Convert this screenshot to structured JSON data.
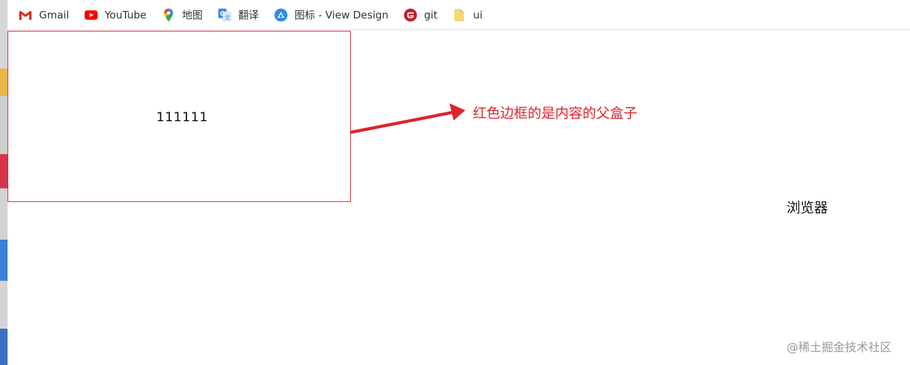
{
  "bookmarks": [
    {
      "label": "Gmail",
      "icon": "gmail-icon"
    },
    {
      "label": "YouTube",
      "icon": "youtube-icon"
    },
    {
      "label": "地图",
      "icon": "maps-pin-icon"
    },
    {
      "label": "翻译",
      "icon": "translate-icon"
    },
    {
      "label": "图标 - View Design",
      "icon": "view-design-icon"
    },
    {
      "label": "git",
      "icon": "gitee-icon"
    },
    {
      "label": "ui",
      "icon": "folder-icon"
    }
  ],
  "content": {
    "box_text": "111111",
    "annotation": "红色边框的是内容的父盒子",
    "browser_label": "浏览器"
  },
  "watermark": "@稀土掘金技术社区",
  "colors": {
    "box_border": "#d9272e",
    "annotation": "#e0232b",
    "gmail": "#d93025",
    "youtube": "#ff0000",
    "gitee": "#c71d23",
    "folder": "#f5d36b"
  }
}
